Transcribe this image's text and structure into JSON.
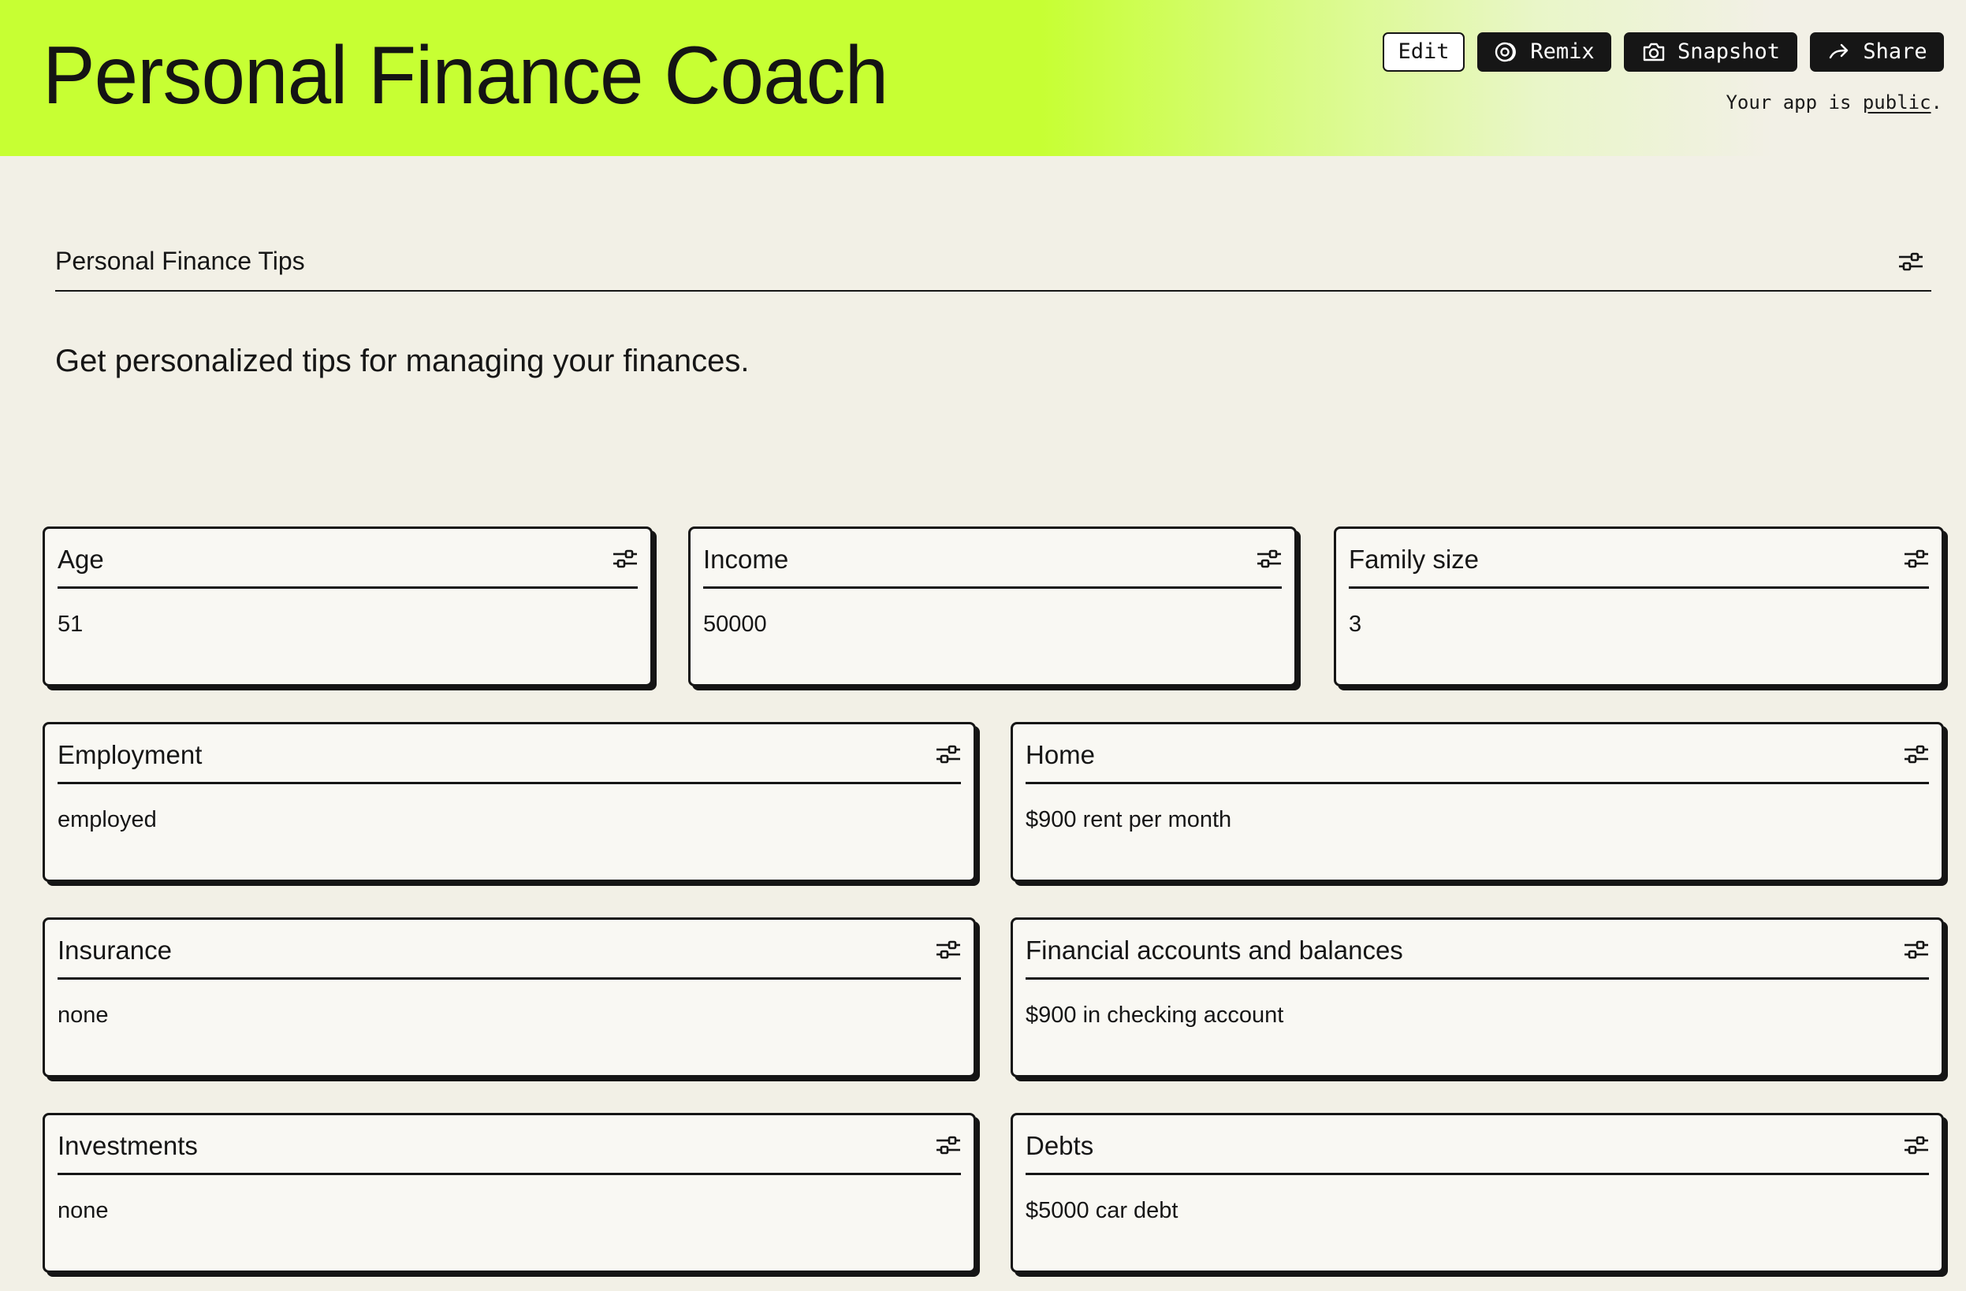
{
  "header": {
    "title": "Personal Finance Coach",
    "buttons": {
      "edit": "Edit",
      "remix": "Remix",
      "snapshot": "Snapshot",
      "share": "Share"
    },
    "public_note": {
      "prefix": "Your app is ",
      "link": "public",
      "suffix": "."
    }
  },
  "section": {
    "title": "Personal Finance Tips",
    "settings_icon": "sliders-icon",
    "subtitle": "Get personalized tips for managing your finances."
  },
  "cards": [
    {
      "label": "Age",
      "value": "51"
    },
    {
      "label": "Income",
      "value": "50000"
    },
    {
      "label": "Family size",
      "value": "3"
    },
    {
      "label": "Employment",
      "value": "employed"
    },
    {
      "label": "Home",
      "value": "$900 rent per month"
    },
    {
      "label": "Insurance",
      "value": "none"
    },
    {
      "label": "Financial accounts and balances",
      "value": "$900 in checking account"
    },
    {
      "label": "Investments",
      "value": "none"
    },
    {
      "label": "Debts",
      "value": "$5000 car debt"
    }
  ],
  "colors": {
    "accent": "#c7ff33",
    "background": "#f2f0e6",
    "card_background": "#f9f8f3",
    "ink": "#141414"
  }
}
